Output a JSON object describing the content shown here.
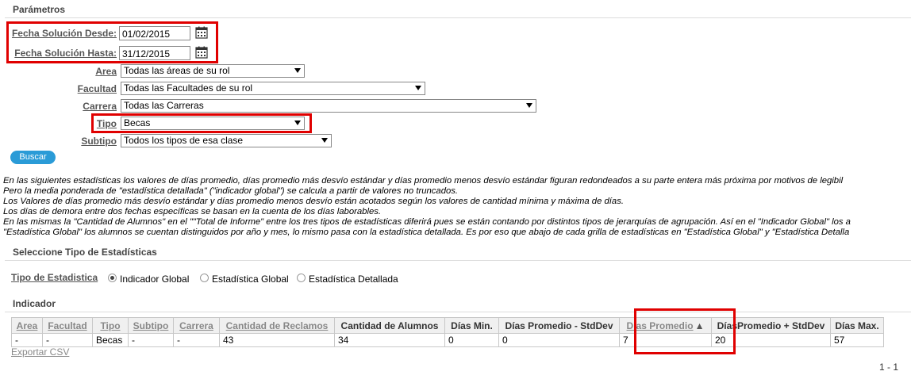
{
  "params": {
    "title": "Parámetros",
    "fecha_desde": {
      "label": "Fecha Solución Desde:",
      "value": "01/02/2015"
    },
    "fecha_hasta": {
      "label": "Fecha Solución Hasta:",
      "value": "31/12/2015"
    },
    "area": {
      "label": "Area",
      "value": "Todas las áreas de su rol"
    },
    "facultad": {
      "label": "Facultad",
      "value": "Todas las Facultades de su rol"
    },
    "carrera": {
      "label": "Carrera",
      "value": "Todas las Carreras"
    },
    "tipo": {
      "label": "Tipo",
      "value": "Becas"
    },
    "subtipo": {
      "label": "Subtipo",
      "value": "Todos los tipos de esa clase"
    },
    "buscar_label": "Buscar"
  },
  "info_lines": [
    "En las siguientes estadísticas los valores de días promedio, días promedio más desvío estándar y días promedio menos desvío estándar figuran redondeados a su parte entera más próxima por motivos de legibil",
    "Pero la media ponderada de \"estadística detallada\" (\"indicador global\") se calcula a partir de valores no truncados.",
    "Los Valores de días promedio más desvío estándar y días promedio menos desvío están acotados según los valores de cantidad mínima y máxima de días.",
    "Los días de demora entre dos fechas específicas se basan en la cuenta de los días laborables.",
    "En las mismas la \"Cantidad de Alumnos\" en el \"\"Total de Informe\" entre los tres tipos de estadísticas diferirá pues se están contando por distintos tipos de jerarquías de agrupación. Así en el \"Indicador Global\" los a",
    "\"Estadística Global\" los alumnos se cuentan distinguidos por año y mes, lo mismo pasa con la estadística detallada. Es por eso que abajo de cada grilla de estadísticas en \"Estadística Global\" y \"Estadística Detalla"
  ],
  "stats_type": {
    "title": "Seleccione Tipo de Estadísticas",
    "label": "Tipo de Estadistica",
    "options": [
      "Indicador Global",
      "Estadística Global",
      "Estadística Detallada"
    ],
    "selected": "Indicador Global"
  },
  "indicator": {
    "title": "Indicador",
    "headers": [
      "Area",
      "Facultad",
      "Tipo",
      "Subtipo",
      "Carrera",
      "Cantidad de Reclamos",
      "Cantidad de Alumnos",
      "Días Min.",
      "Días Promedio - StdDev",
      "Días Promedio",
      "DíasPromedio + StdDev",
      "Días Max."
    ],
    "sort_indicator": "▲",
    "row": [
      "-",
      "-",
      "Becas",
      "-",
      "-",
      "43",
      "34",
      "0",
      "0",
      "7",
      "20",
      "57"
    ],
    "export_label": "Exportar CSV",
    "pager": "1 - 1"
  }
}
